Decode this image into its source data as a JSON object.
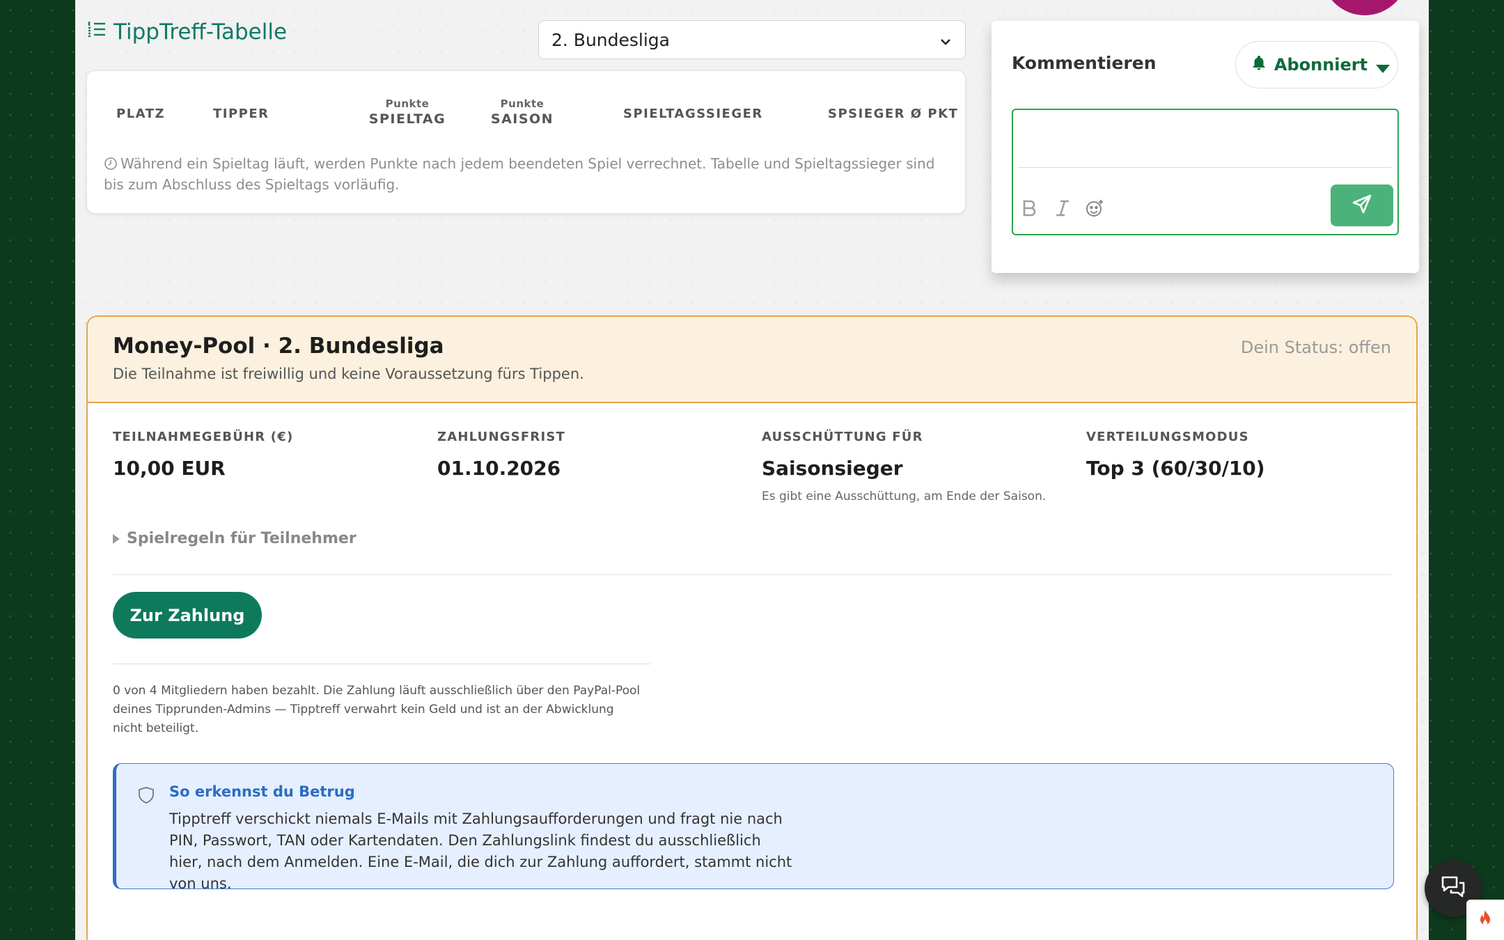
{
  "tabelle": {
    "title": "TippTreff-Tabelle",
    "title_icon": "list-ordered-icon",
    "league_selected": "2. Bundesliga",
    "columns": {
      "platz": "PLATZ",
      "tipper": "TIPPER",
      "spieltag_small": "Punkte",
      "spieltag_big": "SPIELTAG",
      "saison_small": "Punkte",
      "saison_big": "SAISON",
      "spieltagssieger": "SPIELTAGSSIEGER",
      "spsieger": "SPSIEGER Ø PKT"
    },
    "note": "Während ein Spieltag läuft, werden Punkte nach jedem beendeten Spiel verrechnet. Tabelle und Spieltagssieger sind bis zum Abschluss des Spieltags vorläufig."
  },
  "comments": {
    "label": "Kommentieren",
    "subscribe_label": "Abonniert",
    "editor_value": "",
    "tools": [
      "bold-icon",
      "italic-icon",
      "emoji-icon"
    ],
    "send_icon": "send-icon"
  },
  "pool": {
    "title": "Money-Pool · 2. Bundesliga",
    "subtitle": "Die Teilnahme ist freiwillig und keine Voraussetzung fürs Tippen.",
    "status": "Dein Status: offen",
    "fee_label": "TEILNAHMEGEBÜHR (€)",
    "fee_value": "10,00 EUR",
    "deadline_label": "ZAHLUNGSFRIST",
    "deadline_value": "01.10.2026",
    "payout_label": "AUSSCHÜTTUNG FÜR",
    "payout_value": "Saisonsieger",
    "payout_hint": "Es gibt eine Ausschüttung, am Ende der Saison.",
    "mode_label": "VERTEILUNGSMODUS",
    "mode_value": "Top 3 (60/30/10)",
    "rules_label": "Spielregeln für Teilnehmer",
    "pay_button": "Zur Zahlung",
    "pay_note": "0 von 4 Mitgliedern haben bezahlt. Die Zahlung läuft ausschließlich über den PayPal-Pool deines Tipprunden-Admins — Tipptreff verwahrt kein Geld und ist an der Abwicklung nicht beteiligt.",
    "fraud_title": "So erkennst du Betrug",
    "fraud_text": "Tipptreff verschickt niemals E-Mails mit Zahlungsaufforderungen und fragt nie nach PIN, Passwort, TAN oder Kartendaten. Den Zahlungslink findest du ausschließlich hier, nach dem Anmelden. Eine E-Mail, die dich zur Zahlung auffordert, stammt nicht von uns."
  },
  "colors": {
    "brand_green": "#0e7a5c",
    "pool_border": "#e6a74a",
    "info_blue": "#2f6fc4"
  }
}
